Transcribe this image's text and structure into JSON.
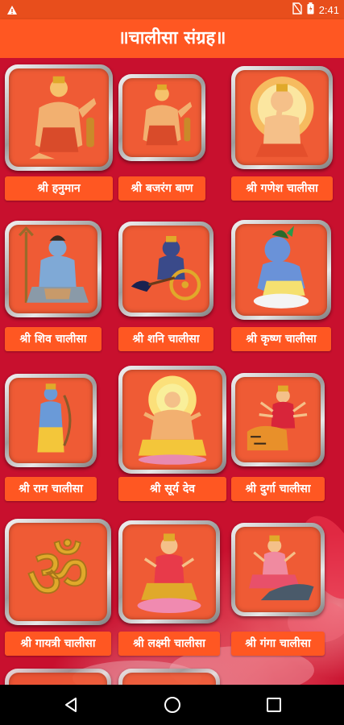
{
  "status": {
    "time": "2:41",
    "icons": [
      "notification-icon",
      "no-sim-icon",
      "battery-icon"
    ]
  },
  "app": {
    "title": "॥चालीसा संग्रह॥"
  },
  "tiles": [
    {
      "label": "श्री हनुमान",
      "icon": "hanuman-image"
    },
    {
      "label": "श्री बजरंग बाण",
      "icon": "hanuman-image"
    },
    {
      "label": "श्री गणेश चालीसा",
      "icon": "ganesh-image"
    },
    {
      "label": "श्री शिव चालीसा",
      "icon": "shiva-image"
    },
    {
      "label": "श्री शनि चालीसा",
      "icon": "shani-image"
    },
    {
      "label": "श्री कृष्ण चालीसा",
      "icon": "krishna-image"
    },
    {
      "label": "श्री राम चालीसा",
      "icon": "ram-image"
    },
    {
      "label": "श्री सूर्य देव",
      "icon": "surya-image"
    },
    {
      "label": "श्री दुर्गा चालीसा",
      "icon": "durga-image"
    },
    {
      "label": "श्री गायत्री चालीसा",
      "icon": "om-image"
    },
    {
      "label": "श्री लक्ष्मी चालीसा",
      "icon": "lakshmi-image"
    },
    {
      "label": "श्री गंगा चालीसा",
      "icon": "ganga-image"
    }
  ],
  "nav": [
    "back-icon",
    "home-icon",
    "recents-icon"
  ],
  "colors": {
    "accent": "#ff5722",
    "background": "#c8102e",
    "status_bar": "#e84e1c",
    "tile_inner": "#ef5b35"
  }
}
